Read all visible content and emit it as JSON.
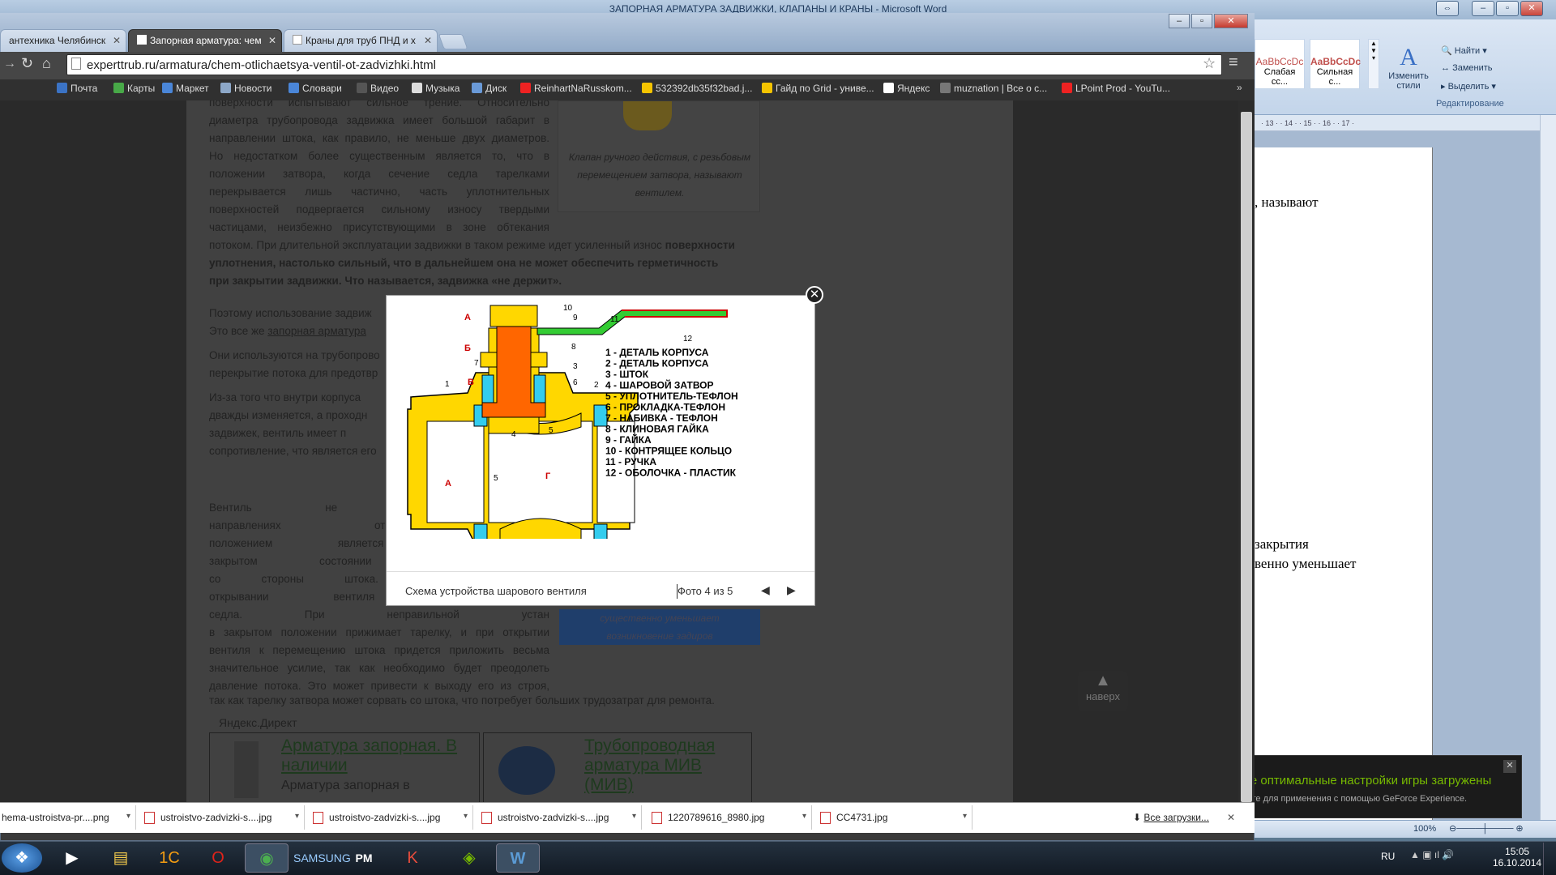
{
  "word": {
    "title": "ЗАПОРНАЯ АРМАТУРА ЗАДВИЖКИ, КЛАПАНЫ И КРАНЫ - Microsoft Word",
    "styles": [
      {
        "sample": "AaBbCcDc",
        "label": "Слабая сс..."
      },
      {
        "sample": "AaBbCcDc",
        "label": "Сильная с..."
      }
    ],
    "change_styles": "Изменить стили",
    "find": "Найти",
    "replace": "Заменить",
    "select": "Выделить",
    "editing_group": "Редактирование",
    "ruler": "· 13 · · 14 · · 15 · · 16 · · 17 ·",
    "text_lines": [
      ", называют",
      "закрытия",
      "венно уменьшает"
    ],
    "zoom": "100%"
  },
  "browser": {
    "tabs": [
      {
        "label": "антехника Челябинск"
      },
      {
        "label": "Запорная арматура: чем"
      },
      {
        "label": "Краны для труб ПНД и х"
      }
    ],
    "url": "experttrub.ru/armatura/chem-otlichaetsya-ventil-ot-zadvizhki.html",
    "bookmarks": [
      {
        "label": "Почта",
        "color": "#3b73c5"
      },
      {
        "label": "Карты",
        "color": "#48a948"
      },
      {
        "label": "Маркет",
        "color": "#4a86d8"
      },
      {
        "label": "Новости",
        "color": "#8da8c8"
      },
      {
        "label": "Словари",
        "color": "#4a86d8"
      },
      {
        "label": "Видео",
        "color": "#555"
      },
      {
        "label": "Музыка",
        "color": "#ddd"
      },
      {
        "label": "Диск",
        "color": "#6a9ad8"
      },
      {
        "label": "ReinhartNaRusskom...",
        "color": "#e22"
      },
      {
        "label": "532392db35f32bad.j...",
        "color": "#f5c400"
      },
      {
        "label": "Гайд по Grid - униве...",
        "color": "#f5c400"
      },
      {
        "label": "Яндекс",
        "color": "#fff"
      },
      {
        "label": "muznation | Все о с...",
        "color": "#777"
      },
      {
        "label": "LPoint Prod - YouTu...",
        "color": "#e22"
      }
    ]
  },
  "article": {
    "paragraph1": [
      "поверхности испытывают сильное трение. Относительно",
      "диаметра трубопровода задвижка имеет большой габарит в",
      "направлении штока, как правило, не меньше двух диаметров.",
      "Но недостатком более существенным является то, что в",
      "положении затвора, когда сечение седла тарелками",
      "перекрывается лишь частично, часть уплотнительных",
      "поверхностей подвергается сильному износу твердыми",
      "частицами, неизбежно присутствующими в зоне обтекания"
    ],
    "paragraph1_tail": "потоком. При длительной эксплуатации задвижки в таком режиме идет усиленный износ",
    "paragraph1_bold1": "поверхности",
    "paragraph1_bold2": "уплотнения, настолько сильный, что в дальнейшем она не может обеспечить герметичность",
    "paragraph1_bold3": "при закрытии задвижки. Что называется, задвижка «не держит».",
    "side_image_caption": [
      "Клапан ручного действия, с резьбовым",
      "перемещением затвора, называют",
      "вентилем."
    ],
    "p2a": "Поэтому использование задвиж",
    "p2b": "Это все же",
    "p2_link": "запорная арматура",
    "p3a": "Они используются на трубопрово",
    "p3b": "перекрытие потока для предотвр",
    "p4": [
      "Из-за того что внутри корпуса",
      "дважды изменяется, а проходн",
      "задвижек, вентиль имеет п",
      "сопротивление, что является его"
    ],
    "p5": [
      "Вентиль не может эксплу",
      "направлениях относительно дв",
      "положением является то напр",
      "закрытом состоянии со стороны",
      "со стороны штока. В этом пол",
      "открывании вентиля даже пом",
      "седла. При неправильной устан",
      "в закрытом положении прижимает тарелку, и при открытии",
      "вентиля к перемещению штока придется приложить весьма",
      "значительное усилие, так как необходимо будет преодолеть",
      "давление потока. Это может привести к выходу его из строя,"
    ],
    "p5_tail": "так как тарелку затвора может сорвать со штока, что потребует больших трудозатрат для ремонта.",
    "side_box": [
      "существенно уменьшает",
      "возникновение задиров"
    ],
    "direct_label": "Яндекс.Директ",
    "ads": [
      {
        "title": "Арматура запорная. В наличии",
        "text": "Арматура запорная в"
      },
      {
        "title": "Трубопроводная арматура МИВ (МИВ)",
        "text": ""
      }
    ],
    "up_button": "наверх"
  },
  "lightbox": {
    "caption": "Схема устройства шарового вентиля",
    "counter": "Фото 4 из 5",
    "legend": [
      "1 - ДЕТАЛЬ КОРПУСА",
      "2 - ДЕТАЛЬ КОРПУСА",
      "3 - ШТОК",
      "4 - ШАРОВОЙ ЗАТВОР",
      "5 - УПЛОТНИТЕЛЬ-ТЕФЛОН",
      "6 - ПРОКЛАДКА-ТЕФЛОН",
      "7 - НАБИВКА - ТЕФЛОН",
      "8 - КЛИНОВАЯ ГАЙКА",
      "9 - ГАЙКА",
      "10 - КОНТРЯЩЕЕ КОЛЬЦО",
      "11 - РУЧКА",
      "12 - ОБОЛОЧКА - ПЛАСТИК"
    ],
    "diagram_labels": {
      "A1": "А",
      "B": "Б",
      "V": "В",
      "A2": "А",
      "G": "Г",
      "n1": "1",
      "n2": "2",
      "n3": "3",
      "n4": "4",
      "n5a": "5",
      "n5b": "5",
      "n6": "6",
      "n7": "7",
      "n8": "8",
      "n9": "9",
      "n10": "10",
      "n11": "11",
      "n12": "12"
    }
  },
  "downloads": {
    "items": [
      "hema-ustroistva-pr....png",
      "ustroistvo-zadvizki-s....jpg",
      "ustroistvo-zadvizki-s....jpg",
      "ustroistvo-zadvizki-s....jpg",
      "1220789616_8980.jpg",
      "CC4731.jpg"
    ],
    "all_link": "Все загрузки..."
  },
  "toast": {
    "title": "Новые оптимальные настройки игры загружены",
    "body": "Щелкните для применения с помощью GeForce Experience."
  },
  "taskbar": {
    "lang": "RU",
    "time": "15:05",
    "date": "16.10.2014"
  },
  "colors": {
    "accent_green": "#76b900",
    "valve_yellow": "#ffd700",
    "valve_orange": "#ff6600",
    "handle_green": "#33cc33"
  }
}
